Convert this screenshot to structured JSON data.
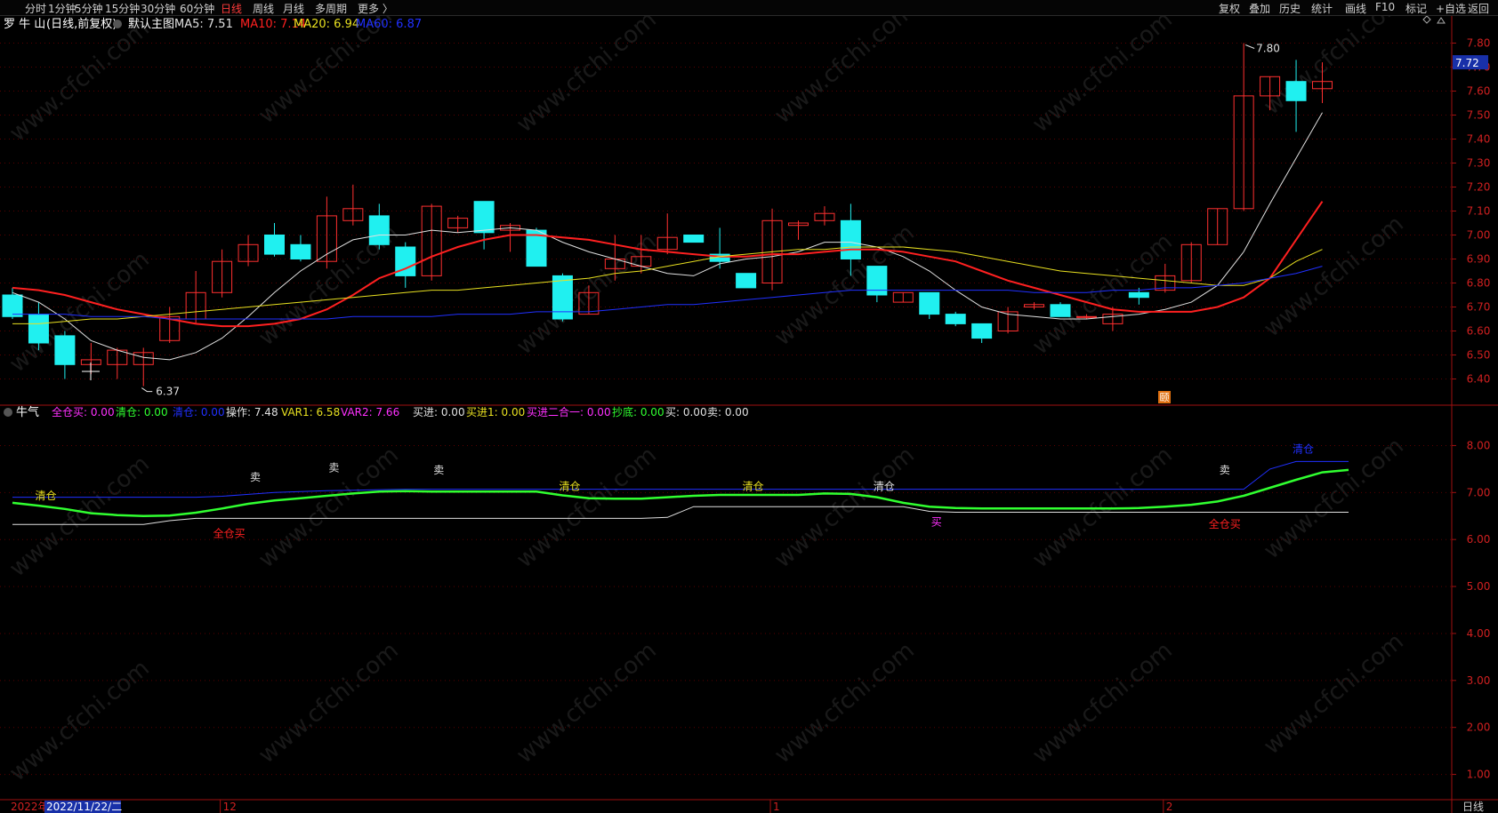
{
  "toolbar": {
    "left_tabs": [
      "分时",
      "1分钟",
      "5分钟",
      "15分钟",
      "30分钟",
      "60分钟",
      "日线",
      "周线",
      "月线",
      "多周期",
      "更多 〉"
    ],
    "active_tab": "日线",
    "right_tabs": [
      "复权",
      "叠加",
      "历史",
      "统计",
      "画线",
      "F10",
      "标记",
      "+自选",
      "返回"
    ]
  },
  "main_panel": {
    "stock_name": "罗 牛 山",
    "period_desc": "(日线,前复权)",
    "chart_label": "默认主图",
    "ma_labels": [
      {
        "text": "MA5: 7.51",
        "color": "#e0e0e0"
      },
      {
        "text": "MA10: 7.14",
        "color": "#ff2020"
      },
      {
        "text": "MA20: 6.94",
        "color": "#e8e020"
      },
      {
        "text": "MA60: 6.87",
        "color": "#2030ff"
      }
    ],
    "current_price": "7.72",
    "high_annotation": "7.80",
    "low_annotation": "6.37",
    "marker_label": "颐"
  },
  "sub_panel": {
    "title": "牛气",
    "labels": [
      {
        "text": "全仓买: 0.00",
        "color": "#ff30ff"
      },
      {
        "text": "清仓: 0.00",
        "color": "#30ff30"
      },
      {
        "text": "清仓: 0.00",
        "color": "#2030ff"
      },
      {
        "text": "操作: 7.48",
        "color": "#e0e0e0"
      },
      {
        "text": "VAR1: 6.58",
        "color": "#e8e020"
      },
      {
        "text": "VAR2: 7.66",
        "color": "#ff30ff"
      },
      {
        "text": "买进: 0.00",
        "color": "#e0e0e0"
      },
      {
        "text": "买进1: 0.00",
        "color": "#e8e020"
      },
      {
        "text": "买进二合一: 0.00",
        "color": "#ff30ff"
      },
      {
        "text": "抄底: 0.00",
        "color": "#30ff30"
      },
      {
        "text": "买: 0.00",
        "color": "#e0e0e0"
      },
      {
        "text": "卖: 0.00",
        "color": "#e0e0e0"
      }
    ]
  },
  "bottom_axis": {
    "year_label": "2022年",
    "cursor_date": "2022/11/22/二",
    "month_labels": [
      "12",
      "1",
      "2"
    ],
    "period_label": "日线"
  },
  "watermark": "www.cfchi.com",
  "chart_data": [
    {
      "type": "candlestick",
      "ylim": [
        6.35,
        7.85
      ],
      "yticks": [
        "6.40",
        "6.50",
        "6.60",
        "6.70",
        "6.80",
        "6.90",
        "7.00",
        "7.10",
        "7.20",
        "7.30",
        "7.40",
        "7.50",
        "7.60",
        "7.70",
        "7.80"
      ],
      "candles": [
        {
          "o": 6.75,
          "h": 6.78,
          "l": 6.65,
          "c": 6.66
        },
        {
          "o": 6.67,
          "h": 6.72,
          "l": 6.52,
          "c": 6.55
        },
        {
          "o": 6.58,
          "h": 6.6,
          "l": 6.4,
          "c": 6.46
        },
        {
          "o": 6.46,
          "h": 6.55,
          "l": 6.42,
          "c": 6.48
        },
        {
          "o": 6.46,
          "h": 6.53,
          "l": 6.4,
          "c": 6.52
        },
        {
          "o": 6.46,
          "h": 6.53,
          "l": 6.37,
          "c": 6.51
        },
        {
          "o": 6.56,
          "h": 6.7,
          "l": 6.55,
          "c": 6.66
        },
        {
          "o": 6.65,
          "h": 6.85,
          "l": 6.63,
          "c": 6.76
        },
        {
          "o": 6.76,
          "h": 6.94,
          "l": 6.74,
          "c": 6.89
        },
        {
          "o": 6.89,
          "h": 7.0,
          "l": 6.87,
          "c": 6.96
        },
        {
          "o": 7.0,
          "h": 7.05,
          "l": 6.91,
          "c": 6.92
        },
        {
          "o": 6.96,
          "h": 7.0,
          "l": 6.89,
          "c": 6.9
        },
        {
          "o": 6.89,
          "h": 7.16,
          "l": 6.86,
          "c": 7.08
        },
        {
          "o": 7.06,
          "h": 7.21,
          "l": 7.04,
          "c": 7.11
        },
        {
          "o": 7.08,
          "h": 7.13,
          "l": 6.94,
          "c": 6.96
        },
        {
          "o": 6.95,
          "h": 6.97,
          "l": 6.78,
          "c": 6.83
        },
        {
          "o": 6.83,
          "h": 7.13,
          "l": 6.81,
          "c": 7.12
        },
        {
          "o": 7.03,
          "h": 7.08,
          "l": 7.01,
          "c": 7.07
        },
        {
          "o": 7.14,
          "h": 7.14,
          "l": 6.94,
          "c": 7.01
        },
        {
          "o": 7.02,
          "h": 7.05,
          "l": 6.93,
          "c": 7.04
        },
        {
          "o": 7.02,
          "h": 7.03,
          "l": 6.88,
          "c": 6.87
        },
        {
          "o": 6.83,
          "h": 6.84,
          "l": 6.64,
          "c": 6.65
        },
        {
          "o": 6.67,
          "h": 6.79,
          "l": 6.67,
          "c": 6.76
        },
        {
          "o": 6.86,
          "h": 7.0,
          "l": 6.81,
          "c": 6.9
        },
        {
          "o": 6.87,
          "h": 7.0,
          "l": 6.84,
          "c": 6.91
        },
        {
          "o": 6.94,
          "h": 7.09,
          "l": 6.92,
          "c": 6.99
        },
        {
          "o": 7.0,
          "h": 7.0,
          "l": 6.97,
          "c": 6.97
        },
        {
          "o": 6.92,
          "h": 7.03,
          "l": 6.86,
          "c": 6.89
        },
        {
          "o": 6.84,
          "h": 6.84,
          "l": 6.78,
          "c": 6.78
        },
        {
          "o": 6.8,
          "h": 7.11,
          "l": 6.77,
          "c": 7.06
        },
        {
          "o": 7.04,
          "h": 7.06,
          "l": 6.98,
          "c": 7.05
        },
        {
          "o": 7.06,
          "h": 7.12,
          "l": 7.04,
          "c": 7.09
        },
        {
          "o": 7.06,
          "h": 7.13,
          "l": 6.83,
          "c": 6.9
        },
        {
          "o": 6.87,
          "h": 6.87,
          "l": 6.72,
          "c": 6.75
        },
        {
          "o": 6.72,
          "h": 6.76,
          "l": 6.72,
          "c": 6.76
        },
        {
          "o": 6.76,
          "h": 6.76,
          "l": 6.65,
          "c": 6.67
        },
        {
          "o": 6.67,
          "h": 6.68,
          "l": 6.62,
          "c": 6.63
        },
        {
          "o": 6.63,
          "h": 6.63,
          "l": 6.55,
          "c": 6.57
        },
        {
          "o": 6.6,
          "h": 6.7,
          "l": 6.59,
          "c": 6.68
        },
        {
          "o": 6.7,
          "h": 6.72,
          "l": 6.69,
          "c": 6.71
        },
        {
          "o": 6.71,
          "h": 6.72,
          "l": 6.66,
          "c": 6.66
        },
        {
          "o": 6.66,
          "h": 6.67,
          "l": 6.65,
          "c": 6.66
        },
        {
          "o": 6.63,
          "h": 6.7,
          "l": 6.6,
          "c": 6.67
        },
        {
          "o": 6.76,
          "h": 6.78,
          "l": 6.71,
          "c": 6.74
        },
        {
          "o": 6.77,
          "h": 6.88,
          "l": 6.76,
          "c": 6.83
        },
        {
          "o": 6.81,
          "h": 6.97,
          "l": 6.8,
          "c": 6.96
        },
        {
          "o": 6.96,
          "h": 7.11,
          "l": 6.96,
          "c": 7.11
        },
        {
          "o": 7.11,
          "h": 7.8,
          "l": 7.1,
          "c": 7.58
        },
        {
          "o": 7.58,
          "h": 7.66,
          "l": 7.52,
          "c": 7.66
        },
        {
          "o": 7.64,
          "h": 7.73,
          "l": 7.43,
          "c": 7.56
        },
        {
          "o": 7.61,
          "h": 7.72,
          "l": 7.55,
          "c": 7.64
        }
      ],
      "series": [
        {
          "name": "MA5",
          "color": "#e0e0e0",
          "values": [
            6.76,
            6.72,
            6.65,
            6.56,
            6.52,
            6.49,
            6.48,
            6.51,
            6.57,
            6.66,
            6.76,
            6.85,
            6.92,
            6.98,
            7.0,
            7.0,
            7.02,
            7.01,
            7.02,
            7.03,
            7.02,
            6.97,
            6.93,
            6.9,
            6.87,
            6.84,
            6.83,
            6.88,
            6.9,
            6.91,
            6.93,
            6.97,
            6.97,
            6.95,
            6.91,
            6.85,
            6.77,
            6.7,
            6.67,
            6.66,
            6.65,
            6.65,
            6.66,
            6.67,
            6.69,
            6.72,
            6.79,
            6.93,
            7.13,
            7.32,
            7.51
          ]
        },
        {
          "name": "MA10",
          "color": "#ff2020",
          "values": [
            6.78,
            6.77,
            6.75,
            6.72,
            6.69,
            6.67,
            6.65,
            6.63,
            6.62,
            6.62,
            6.63,
            6.65,
            6.69,
            6.75,
            6.82,
            6.86,
            6.91,
            6.95,
            6.98,
            7.0,
            7.0,
            6.99,
            6.98,
            6.96,
            6.94,
            6.93,
            6.92,
            6.91,
            6.91,
            6.92,
            6.92,
            6.93,
            6.94,
            6.94,
            6.93,
            6.91,
            6.89,
            6.85,
            6.81,
            6.78,
            6.75,
            6.72,
            6.69,
            6.68,
            6.68,
            6.68,
            6.7,
            6.74,
            6.82,
            6.98,
            7.14
          ]
        },
        {
          "name": "MA20",
          "color": "#e8e020",
          "values": [
            6.63,
            6.63,
            6.64,
            6.65,
            6.65,
            6.66,
            6.67,
            6.68,
            6.69,
            6.7,
            6.71,
            6.72,
            6.73,
            6.74,
            6.75,
            6.76,
            6.77,
            6.77,
            6.78,
            6.79,
            6.8,
            6.81,
            6.82,
            6.84,
            6.85,
            6.87,
            6.89,
            6.91,
            6.92,
            6.93,
            6.94,
            6.94,
            6.95,
            6.95,
            6.95,
            6.94,
            6.93,
            6.91,
            6.89,
            6.87,
            6.85,
            6.84,
            6.83,
            6.82,
            6.81,
            6.8,
            6.79,
            6.79,
            6.82,
            6.89,
            6.94
          ]
        },
        {
          "name": "MA60",
          "color": "#2030ff",
          "values": [
            6.67,
            6.67,
            6.67,
            6.66,
            6.66,
            6.66,
            6.65,
            6.65,
            6.65,
            6.65,
            6.65,
            6.65,
            6.65,
            6.66,
            6.66,
            6.66,
            6.66,
            6.67,
            6.67,
            6.67,
            6.68,
            6.68,
            6.68,
            6.69,
            6.7,
            6.71,
            6.71,
            6.72,
            6.73,
            6.74,
            6.75,
            6.76,
            6.77,
            6.77,
            6.77,
            6.77,
            6.77,
            6.77,
            6.77,
            6.76,
            6.76,
            6.76,
            6.77,
            6.77,
            6.78,
            6.78,
            6.79,
            6.8,
            6.82,
            6.84,
            6.87
          ]
        }
      ]
    },
    {
      "type": "line",
      "ylim": [
        0.5,
        8.5
      ],
      "yticks": [
        "1.00",
        "2.00",
        "3.00",
        "4.00",
        "5.00",
        "6.00",
        "7.00",
        "8.00"
      ],
      "series": [
        {
          "name": "操作",
          "color": "#30ff30",
          "values": [
            6.78,
            6.72,
            6.65,
            6.56,
            6.52,
            6.5,
            6.51,
            6.57,
            6.66,
            6.76,
            6.83,
            6.88,
            6.93,
            6.98,
            7.02,
            7.03,
            7.02,
            7.02,
            7.02,
            7.02,
            7.02,
            6.94,
            6.88,
            6.87,
            6.87,
            6.9,
            6.93,
            6.95,
            6.95,
            6.95,
            6.95,
            6.98,
            6.97,
            6.9,
            6.78,
            6.7,
            6.67,
            6.66,
            6.66,
            6.66,
            6.66,
            6.66,
            6.66,
            6.67,
            6.7,
            6.74,
            6.81,
            6.93,
            7.1,
            7.27,
            7.43,
            7.48
          ]
        },
        {
          "name": "VAR1",
          "color": "#e0e0e0",
          "values": [
            6.32,
            6.32,
            6.32,
            6.32,
            6.32,
            6.32,
            6.4,
            6.45,
            6.45,
            6.45,
            6.45,
            6.45,
            6.45,
            6.45,
            6.45,
            6.45,
            6.45,
            6.45,
            6.45,
            6.45,
            6.45,
            6.45,
            6.45,
            6.45,
            6.45,
            6.47,
            6.7,
            6.7,
            6.7,
            6.7,
            6.7,
            6.7,
            6.7,
            6.7,
            6.7,
            6.6,
            6.58,
            6.58,
            6.58,
            6.58,
            6.58,
            6.58,
            6.58,
            6.58,
            6.58,
            6.58,
            6.58,
            6.58,
            6.58,
            6.58,
            6.58,
            6.58
          ]
        },
        {
          "name": "VAR2",
          "color": "#2030ff",
          "values": [
            6.9,
            6.9,
            6.9,
            6.9,
            6.9,
            6.9,
            6.9,
            6.9,
            6.92,
            6.96,
            7.0,
            7.02,
            7.04,
            7.05,
            7.06,
            7.07,
            7.07,
            7.07,
            7.07,
            7.07,
            7.07,
            7.07,
            7.07,
            7.07,
            7.07,
            7.07,
            7.07,
            7.07,
            7.07,
            7.07,
            7.07,
            7.07,
            7.07,
            7.07,
            7.07,
            7.07,
            7.07,
            7.07,
            7.07,
            7.07,
            7.07,
            7.07,
            7.07,
            7.07,
            7.07,
            7.07,
            7.07,
            7.07,
            7.5,
            7.66,
            7.66,
            7.66
          ]
        }
      ],
      "annotations": [
        {
          "text": "清仓",
          "index": 1,
          "y": 6.85,
          "color": "#e8e020"
        },
        {
          "text": "全仓买",
          "index": 8,
          "y": 6.05,
          "color": "#ff2020"
        },
        {
          "text": "卖",
          "index": 9,
          "y": 7.25,
          "color": "#e0e0e0"
        },
        {
          "text": "卖",
          "index": 12,
          "y": 7.45,
          "color": "#e0e0e0"
        },
        {
          "text": "卖",
          "index": 16,
          "y": 7.4,
          "color": "#e0e0e0"
        },
        {
          "text": "清仓",
          "index": 21,
          "y": 7.05,
          "color": "#e8e020"
        },
        {
          "text": "清仓",
          "index": 28,
          "y": 7.05,
          "color": "#e8e020"
        },
        {
          "text": "清仓",
          "index": 33,
          "y": 7.05,
          "color": "#e0e0e0"
        },
        {
          "text": "买",
          "index": 35,
          "y": 6.3,
          "color": "#ff30ff"
        },
        {
          "text": "卖",
          "index": 46,
          "y": 7.4,
          "color": "#e0e0e0"
        },
        {
          "text": "全仓买",
          "index": 46,
          "y": 6.25,
          "color": "#ff2020"
        },
        {
          "text": "清仓",
          "index": 49,
          "y": 7.85,
          "color": "#2030ff"
        }
      ]
    }
  ]
}
